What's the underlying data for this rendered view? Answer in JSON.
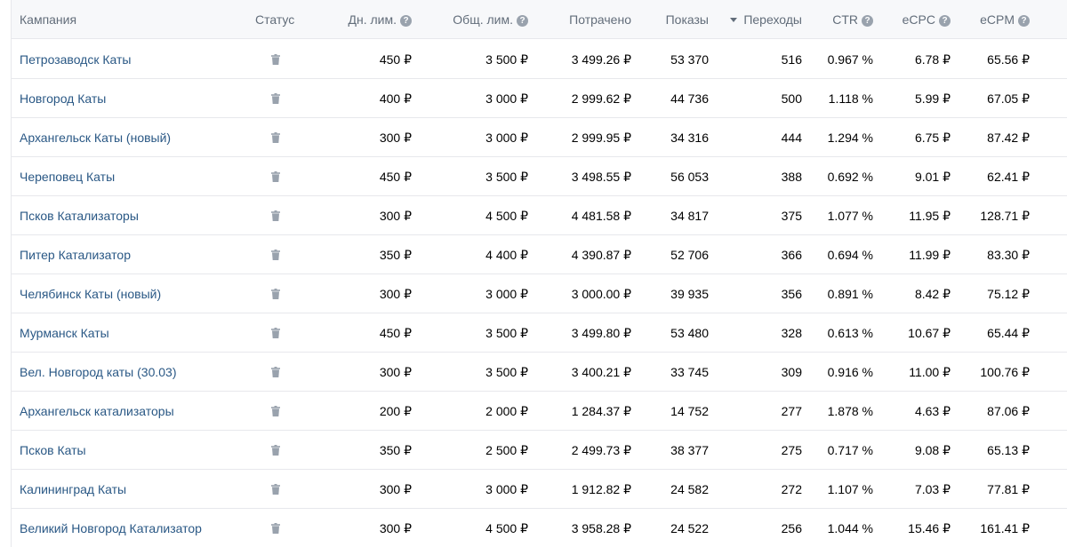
{
  "colors": {
    "header_background": "#f7f8fa",
    "header_text": "#626d7a",
    "link": "#2a5885",
    "border": "#e7e8ec",
    "icon": "#99a2ad"
  },
  "table": {
    "headers": {
      "campaign": "Кампания",
      "status": "Статус",
      "daily_limit": "Дн. лим.",
      "total_limit": "Общ. лим.",
      "spent": "Потрачено",
      "impressions": "Показы",
      "clicks": "Переходы",
      "ctr": "CTR",
      "ecpc": "eCPC",
      "ecpm": "eCPM"
    },
    "help_icon": "question-circle-icon",
    "sort_icon": "sort-descending-icon",
    "status_icon": "trash-icon",
    "rows": [
      {
        "campaign": "Петрозаводск Каты",
        "daily_limit": "450 ₽",
        "total_limit": "3 500 ₽",
        "spent": "3 499.26 ₽",
        "impressions": "53 370",
        "clicks": "516",
        "ctr": "0.967 %",
        "ecpc": "6.78 ₽",
        "ecpm": "65.56 ₽"
      },
      {
        "campaign": "Новгород Каты",
        "daily_limit": "400 ₽",
        "total_limit": "3 000 ₽",
        "spent": "2 999.62 ₽",
        "impressions": "44 736",
        "clicks": "500",
        "ctr": "1.118 %",
        "ecpc": "5.99 ₽",
        "ecpm": "67.05 ₽"
      },
      {
        "campaign": "Архангельск Каты (новый)",
        "daily_limit": "300 ₽",
        "total_limit": "3 000 ₽",
        "spent": "2 999.95 ₽",
        "impressions": "34 316",
        "clicks": "444",
        "ctr": "1.294 %",
        "ecpc": "6.75 ₽",
        "ecpm": "87.42 ₽"
      },
      {
        "campaign": "Череповец Каты",
        "daily_limit": "450 ₽",
        "total_limit": "3 500 ₽",
        "spent": "3 498.55 ₽",
        "impressions": "56 053",
        "clicks": "388",
        "ctr": "0.692 %",
        "ecpc": "9.01 ₽",
        "ecpm": "62.41 ₽"
      },
      {
        "campaign": "Псков Катализаторы",
        "daily_limit": "300 ₽",
        "total_limit": "4 500 ₽",
        "spent": "4 481.58 ₽",
        "impressions": "34 817",
        "clicks": "375",
        "ctr": "1.077 %",
        "ecpc": "11.95 ₽",
        "ecpm": "128.71 ₽"
      },
      {
        "campaign": "Питер Катализатор",
        "daily_limit": "350 ₽",
        "total_limit": "4 400 ₽",
        "spent": "4 390.87 ₽",
        "impressions": "52 706",
        "clicks": "366",
        "ctr": "0.694 %",
        "ecpc": "11.99 ₽",
        "ecpm": "83.30 ₽"
      },
      {
        "campaign": "Челябинск Каты (новый)",
        "daily_limit": "300 ₽",
        "total_limit": "3 000 ₽",
        "spent": "3 000.00 ₽",
        "impressions": "39 935",
        "clicks": "356",
        "ctr": "0.891 %",
        "ecpc": "8.42 ₽",
        "ecpm": "75.12 ₽"
      },
      {
        "campaign": "Мурманск Каты",
        "daily_limit": "450 ₽",
        "total_limit": "3 500 ₽",
        "spent": "3 499.80 ₽",
        "impressions": "53 480",
        "clicks": "328",
        "ctr": "0.613 %",
        "ecpc": "10.67 ₽",
        "ecpm": "65.44 ₽"
      },
      {
        "campaign": "Вел. Новгород каты (30.03)",
        "daily_limit": "300 ₽",
        "total_limit": "3 500 ₽",
        "spent": "3 400.21 ₽",
        "impressions": "33 745",
        "clicks": "309",
        "ctr": "0.916 %",
        "ecpc": "11.00 ₽",
        "ecpm": "100.76 ₽"
      },
      {
        "campaign": "Архангельск катализаторы",
        "daily_limit": "200 ₽",
        "total_limit": "2 000 ₽",
        "spent": "1 284.37 ₽",
        "impressions": "14 752",
        "clicks": "277",
        "ctr": "1.878 %",
        "ecpc": "4.63 ₽",
        "ecpm": "87.06 ₽"
      },
      {
        "campaign": "Псков Каты",
        "daily_limit": "350 ₽",
        "total_limit": "2 500 ₽",
        "spent": "2 499.73 ₽",
        "impressions": "38 377",
        "clicks": "275",
        "ctr": "0.717 %",
        "ecpc": "9.08 ₽",
        "ecpm": "65.13 ₽"
      },
      {
        "campaign": "Калининград Каты",
        "daily_limit": "300 ₽",
        "total_limit": "3 000 ₽",
        "spent": "1 912.82 ₽",
        "impressions": "24 582",
        "clicks": "272",
        "ctr": "1.107 %",
        "ecpc": "7.03 ₽",
        "ecpm": "77.81 ₽"
      },
      {
        "campaign": "Великий Новгород Катализатор",
        "daily_limit": "300 ₽",
        "total_limit": "4 500 ₽",
        "spent": "3 958.28 ₽",
        "impressions": "24 522",
        "clicks": "256",
        "ctr": "1.044 %",
        "ecpc": "15.46 ₽",
        "ecpm": "161.41 ₽"
      }
    ]
  }
}
